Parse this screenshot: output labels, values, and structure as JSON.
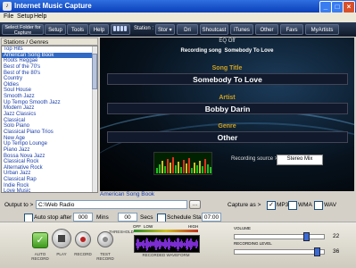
{
  "window": {
    "title": "Internet Music Capture",
    "icon": "music-note-icon"
  },
  "menu": [
    "File",
    "Setup",
    "Help"
  ],
  "toolbar": {
    "select_folder_line1": "Select Folder for",
    "select_folder_line2": "Capture",
    "setup": "Setup",
    "tools": "Tools",
    "help": "Help",
    "station_label": "Station :",
    "station_value": "Stor",
    "links": [
      "Dri",
      "Shoutcast",
      "iTunes",
      "Other",
      "Favs",
      "MyArtists"
    ]
  },
  "stations": {
    "header": "Stations / Genres",
    "items": [
      "Top Hits",
      "American Song Book",
      "Roots Reggae",
      "Best of the 70's",
      "Best of the 80's",
      "Country",
      "Oldies",
      "Soul House",
      "Smooth Jazz",
      "Up Tempo Smooth Jazz",
      "Modern Jazz",
      "Jazz Classics",
      "Classical",
      "Solo Piano",
      "Classical Piano Trios",
      "New Age",
      "Up Tempo Lounge",
      "Piano Jazz",
      "Bossa Nova Jazz",
      "Classical Rock",
      "Alternative Rock",
      "Urban Jazz",
      "Classical Rap",
      "Indie Rock",
      "Love Music"
    ],
    "selected_index": 1
  },
  "display": {
    "eq": "EQ Off",
    "recording_prefix": "Recording song",
    "recording_song": "Somebody To Love",
    "song_title_label": "Song Title",
    "song_title": "Somebody To Love",
    "artist_label": "Artist",
    "artist": "Bobby Darin",
    "genre_label": "Genre",
    "genre": "Other",
    "recording_source_label": "Recording source >",
    "recording_source": "Stereo Mix"
  },
  "bottom": {
    "current_genre": "American Song Book",
    "output_label": "Output to >",
    "output_path": "C:\\Web Radio",
    "capture_as_label": "Capture as >",
    "formats": [
      {
        "label": "MP3",
        "checked": true
      },
      {
        "label": "WMA",
        "checked": false
      },
      {
        "label": "WAV",
        "checked": false
      }
    ],
    "auto_stop_label": "Auto stop after",
    "auto_stop_mins": "000",
    "mins_label": "Mins",
    "auto_stop_secs": "00",
    "secs_label": "Secs",
    "schedule_label": "Schedule Start",
    "schedule_time": "07:00"
  },
  "controls": {
    "auto_record": "AUTO RECORD",
    "play": "PLAY",
    "record": "RECORD",
    "test_record": "TEST RECORD",
    "threshold": "THRESHOLD",
    "off": "OFF",
    "low": "LOW",
    "high": "HIGH",
    "recorded_waveform": "RECORDED WAVEFORM",
    "volume_label": "VOLUME",
    "volume_value": "22",
    "recording_level_label": "RECORDING LEVEL",
    "recording_level_value": "36"
  },
  "colors": {
    "accent": "#316ac5",
    "gold": "#d0a020",
    "titlebar": "#0a3fb8"
  }
}
